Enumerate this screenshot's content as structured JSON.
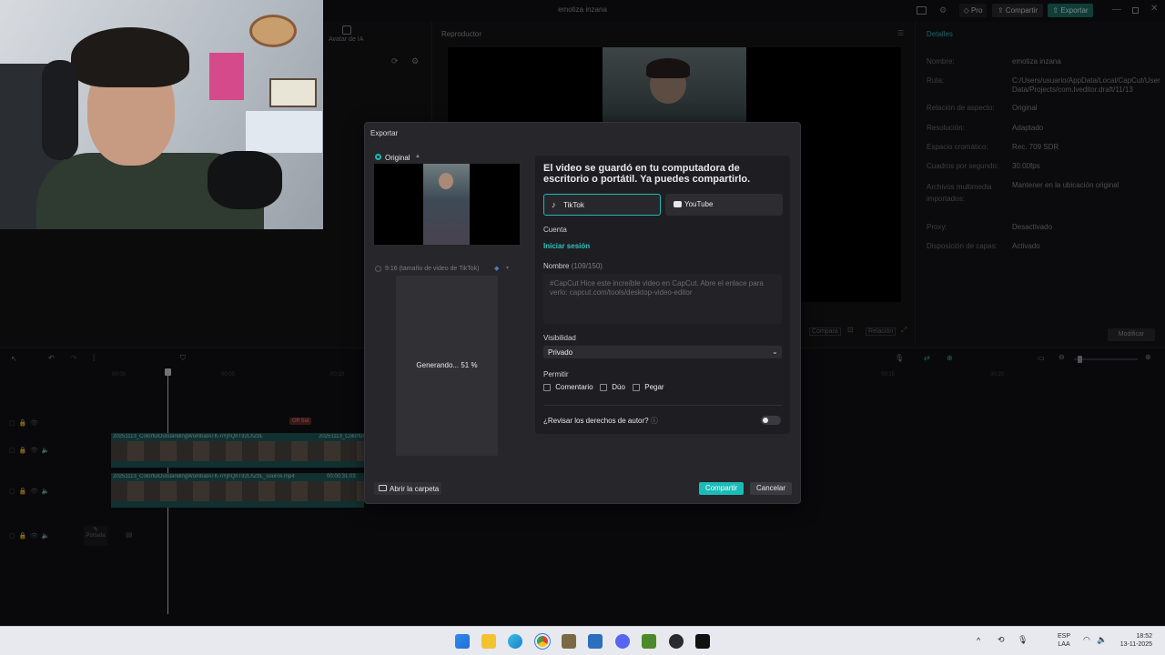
{
  "window": {
    "title": "emotiza inzana",
    "pro_label": "Pro",
    "share_label": "Compartir",
    "export_label": "Exportar"
  },
  "left_panel": {
    "avatar_label": "Avatar de IA"
  },
  "player": {
    "title": "Reproductor",
    "compare_label": "Compara",
    "ratio_label": "Relación"
  },
  "details": {
    "title": "Detalles",
    "rows": [
      {
        "label": "Nombre:",
        "value": "emotiza inzana"
      },
      {
        "label": "Ruta:",
        "value": "C:/Users/usuario/AppData/Local/CapCut/User Data/Projects/com.lveditor.draft/11/13"
      },
      {
        "label": "Relación de aspecto:",
        "value": "Original"
      },
      {
        "label": "Resolución:",
        "value": "Adaptado"
      },
      {
        "label": "Espacio cromático:",
        "value": "Rec. 709 SDR"
      },
      {
        "label": "Cuadros por segundo:",
        "value": "30.00fps"
      },
      {
        "label": "Archivos multimedia importados:",
        "value": "Mantener en la ubicación original"
      },
      {
        "label": "Proxy:",
        "value": "Desactivado"
      },
      {
        "label": "Disposición de capas:",
        "value": "Activado"
      }
    ],
    "modify_label": "Modificar"
  },
  "timeline": {
    "times": [
      "00:00",
      "00:05",
      "00:10",
      "00:15",
      "00:20"
    ],
    "clip1_label": "20251113_ColorfulOutstandingWombatATK-nYjhQhT92LhZbL",
    "clip2_label": "20251113_ColorfulOutstandingWombatATK-nYjhQhT92LhZbL_source.mp4",
    "clip2_duration": "00:00:31:03",
    "clip_short": "20251113_ColorfulC",
    "cover_label": "Portada",
    "marker_label": "Off Sal"
  },
  "dialog": {
    "title": "Exportar",
    "original_label": "Original",
    "format_label": "9:16 (tamaño de video de TikTok)",
    "generating_label": "Generando... 51 %",
    "progress": 0.51,
    "saved_message": "El video se guardó en tu computadora de escritorio o portátil. Ya puedes compartirlo.",
    "tabs": [
      {
        "label": "TikTok"
      },
      {
        "label": "YouTube"
      }
    ],
    "account_label": "Cuenta",
    "login_label": "Iniciar sesión",
    "name_label": "Nombre",
    "name_count": "(109/150)",
    "name_placeholder": "#CapCut Hice este increíble video en CapCut. Abre el enlace para verlo: capcut.com/tools/desktop-video-editor",
    "visibility_label": "Visibilidad",
    "visibility_value": "Privado",
    "allow_label": "Permitir",
    "allow_options": [
      {
        "label": "Comentario"
      },
      {
        "label": "Dúo"
      },
      {
        "label": "Pegar"
      }
    ],
    "copyright_label": "¿Revisar los derechos de autor?",
    "open_folder_label": "Abrir la carpeta",
    "share_label": "Compartir",
    "cancel_label": "Cancelar"
  },
  "taskbar": {
    "lang": "ESP",
    "region": "LAA",
    "time": "18:52",
    "date": "13-11-2025"
  },
  "colors": {
    "accent": "#1bbbb8",
    "export": "#1e6f67"
  }
}
